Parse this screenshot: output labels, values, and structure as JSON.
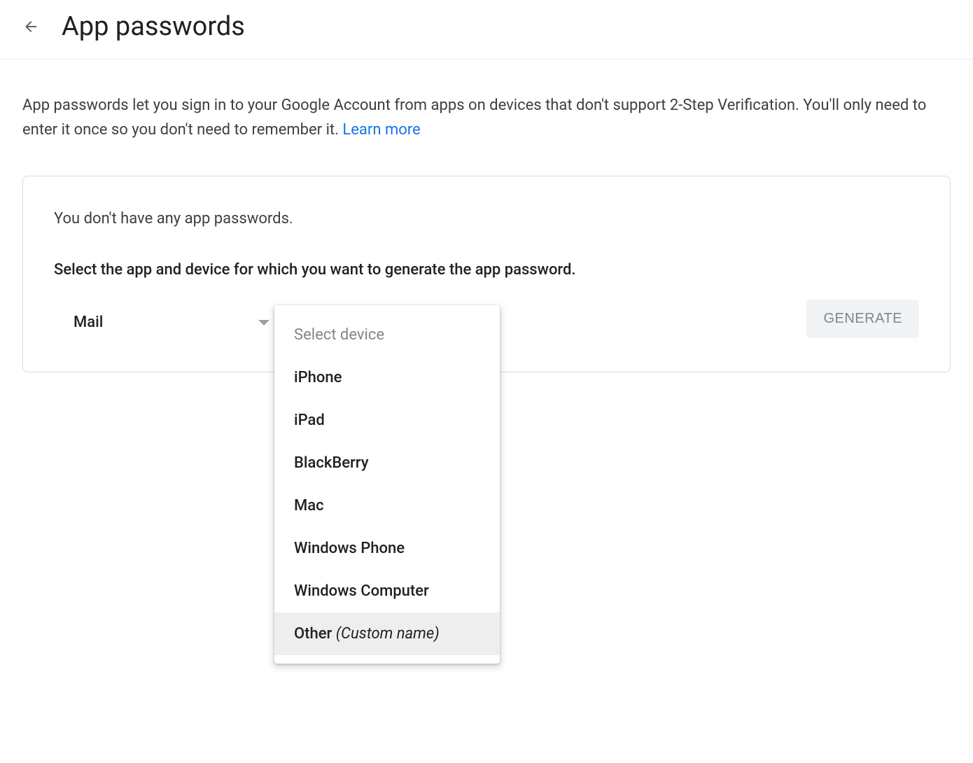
{
  "header": {
    "title": "App passwords"
  },
  "description": {
    "text": "App passwords let you sign in to your Google Account from apps on devices that don't support 2-Step Verification. You'll only need to enter it once so you don't need to remember it. ",
    "learn_more_label": "Learn more"
  },
  "card": {
    "no_passwords": "You don't have any app passwords.",
    "instruction": "Select the app and device for which you want to generate the app password.",
    "app_select": {
      "value": "Mail"
    },
    "device_select": {
      "placeholder": "Select device",
      "options": [
        {
          "label": "iPhone"
        },
        {
          "label": "iPad"
        },
        {
          "label": "BlackBerry"
        },
        {
          "label": "Mac"
        },
        {
          "label": "Windows Phone"
        },
        {
          "label": "Windows Computer"
        },
        {
          "label": "Other ",
          "suffix": "(Custom name)",
          "highlighted": true
        }
      ]
    },
    "generate_button_label": "GENERATE"
  }
}
